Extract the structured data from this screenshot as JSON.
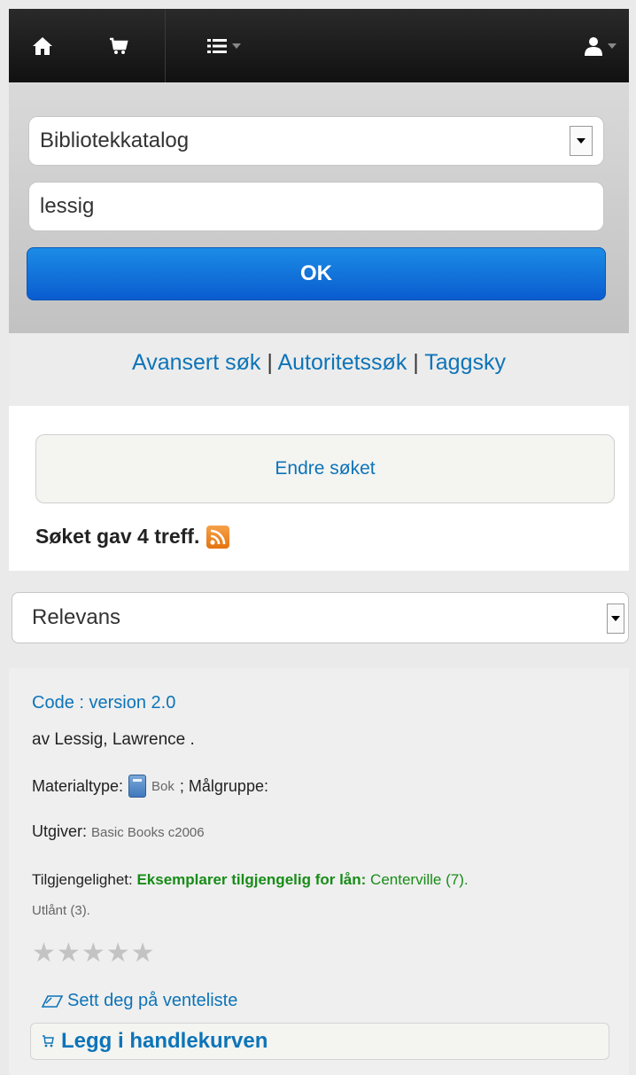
{
  "nav": {
    "home_icon": "home-icon",
    "cart_icon": "cart-icon",
    "list_icon": "list-icon",
    "user_icon": "user-icon"
  },
  "search": {
    "catalog_select": "Bibliotekkatalog",
    "query": "lessig",
    "ok_label": "OK"
  },
  "more_searches": {
    "advanced": "Avansert søk",
    "sep1": " | ",
    "authority": "Autoritetssøk",
    "sep2": " | ",
    "tagcloud": "Taggsky"
  },
  "summary": {
    "modify_label": "Endre søket",
    "hits_text": "Søket gav 4 treff."
  },
  "sort": {
    "selected": "Relevans"
  },
  "result": {
    "title": "Code : version 2.0",
    "author": "av Lessig, Lawrence .",
    "material_label": "Materialtype:",
    "material_value": "Bok",
    "audience_label": "; Målgruppe:",
    "publisher_label": "Utgiver:",
    "publisher_value": "Basic Books c2006",
    "availability_label": "Tilgjengelighet:",
    "availability_status": "Eksemplarer tilgjengelig for lån:",
    "availability_location": "Centerville (7).",
    "checked_out": "Utlånt (3).",
    "rating_stars": 0,
    "hold_label": "Sett deg på venteliste",
    "cart_label": "Legg i handlekurven"
  },
  "colors": {
    "link": "#0d74b8",
    "ok_button": "#0a6fd9",
    "available_green": "#188c18",
    "navbar": "#1f1f1f"
  }
}
